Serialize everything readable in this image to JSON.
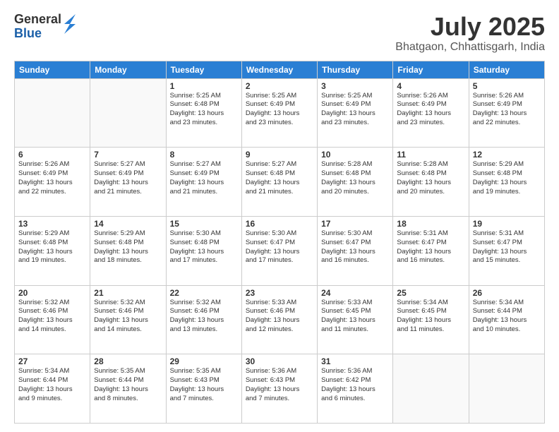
{
  "logo": {
    "general": "General",
    "blue": "Blue"
  },
  "title": "July 2025",
  "subtitle": "Bhatgaon, Chhattisgarh, India",
  "weekdays": [
    "Sunday",
    "Monday",
    "Tuesday",
    "Wednesday",
    "Thursday",
    "Friday",
    "Saturday"
  ],
  "weeks": [
    [
      {
        "day": "",
        "info": ""
      },
      {
        "day": "",
        "info": ""
      },
      {
        "day": "1",
        "info": "Sunrise: 5:25 AM\nSunset: 6:48 PM\nDaylight: 13 hours\nand 23 minutes."
      },
      {
        "day": "2",
        "info": "Sunrise: 5:25 AM\nSunset: 6:49 PM\nDaylight: 13 hours\nand 23 minutes."
      },
      {
        "day": "3",
        "info": "Sunrise: 5:25 AM\nSunset: 6:49 PM\nDaylight: 13 hours\nand 23 minutes."
      },
      {
        "day": "4",
        "info": "Sunrise: 5:26 AM\nSunset: 6:49 PM\nDaylight: 13 hours\nand 23 minutes."
      },
      {
        "day": "5",
        "info": "Sunrise: 5:26 AM\nSunset: 6:49 PM\nDaylight: 13 hours\nand 22 minutes."
      }
    ],
    [
      {
        "day": "6",
        "info": "Sunrise: 5:26 AM\nSunset: 6:49 PM\nDaylight: 13 hours\nand 22 minutes."
      },
      {
        "day": "7",
        "info": "Sunrise: 5:27 AM\nSunset: 6:49 PM\nDaylight: 13 hours\nand 21 minutes."
      },
      {
        "day": "8",
        "info": "Sunrise: 5:27 AM\nSunset: 6:49 PM\nDaylight: 13 hours\nand 21 minutes."
      },
      {
        "day": "9",
        "info": "Sunrise: 5:27 AM\nSunset: 6:48 PM\nDaylight: 13 hours\nand 21 minutes."
      },
      {
        "day": "10",
        "info": "Sunrise: 5:28 AM\nSunset: 6:48 PM\nDaylight: 13 hours\nand 20 minutes."
      },
      {
        "day": "11",
        "info": "Sunrise: 5:28 AM\nSunset: 6:48 PM\nDaylight: 13 hours\nand 20 minutes."
      },
      {
        "day": "12",
        "info": "Sunrise: 5:29 AM\nSunset: 6:48 PM\nDaylight: 13 hours\nand 19 minutes."
      }
    ],
    [
      {
        "day": "13",
        "info": "Sunrise: 5:29 AM\nSunset: 6:48 PM\nDaylight: 13 hours\nand 19 minutes."
      },
      {
        "day": "14",
        "info": "Sunrise: 5:29 AM\nSunset: 6:48 PM\nDaylight: 13 hours\nand 18 minutes."
      },
      {
        "day": "15",
        "info": "Sunrise: 5:30 AM\nSunset: 6:48 PM\nDaylight: 13 hours\nand 17 minutes."
      },
      {
        "day": "16",
        "info": "Sunrise: 5:30 AM\nSunset: 6:47 PM\nDaylight: 13 hours\nand 17 minutes."
      },
      {
        "day": "17",
        "info": "Sunrise: 5:30 AM\nSunset: 6:47 PM\nDaylight: 13 hours\nand 16 minutes."
      },
      {
        "day": "18",
        "info": "Sunrise: 5:31 AM\nSunset: 6:47 PM\nDaylight: 13 hours\nand 16 minutes."
      },
      {
        "day": "19",
        "info": "Sunrise: 5:31 AM\nSunset: 6:47 PM\nDaylight: 13 hours\nand 15 minutes."
      }
    ],
    [
      {
        "day": "20",
        "info": "Sunrise: 5:32 AM\nSunset: 6:46 PM\nDaylight: 13 hours\nand 14 minutes."
      },
      {
        "day": "21",
        "info": "Sunrise: 5:32 AM\nSunset: 6:46 PM\nDaylight: 13 hours\nand 14 minutes."
      },
      {
        "day": "22",
        "info": "Sunrise: 5:32 AM\nSunset: 6:46 PM\nDaylight: 13 hours\nand 13 minutes."
      },
      {
        "day": "23",
        "info": "Sunrise: 5:33 AM\nSunset: 6:46 PM\nDaylight: 13 hours\nand 12 minutes."
      },
      {
        "day": "24",
        "info": "Sunrise: 5:33 AM\nSunset: 6:45 PM\nDaylight: 13 hours\nand 11 minutes."
      },
      {
        "day": "25",
        "info": "Sunrise: 5:34 AM\nSunset: 6:45 PM\nDaylight: 13 hours\nand 11 minutes."
      },
      {
        "day": "26",
        "info": "Sunrise: 5:34 AM\nSunset: 6:44 PM\nDaylight: 13 hours\nand 10 minutes."
      }
    ],
    [
      {
        "day": "27",
        "info": "Sunrise: 5:34 AM\nSunset: 6:44 PM\nDaylight: 13 hours\nand 9 minutes."
      },
      {
        "day": "28",
        "info": "Sunrise: 5:35 AM\nSunset: 6:44 PM\nDaylight: 13 hours\nand 8 minutes."
      },
      {
        "day": "29",
        "info": "Sunrise: 5:35 AM\nSunset: 6:43 PM\nDaylight: 13 hours\nand 7 minutes."
      },
      {
        "day": "30",
        "info": "Sunrise: 5:36 AM\nSunset: 6:43 PM\nDaylight: 13 hours\nand 7 minutes."
      },
      {
        "day": "31",
        "info": "Sunrise: 5:36 AM\nSunset: 6:42 PM\nDaylight: 13 hours\nand 6 minutes."
      },
      {
        "day": "",
        "info": ""
      },
      {
        "day": "",
        "info": ""
      }
    ]
  ]
}
